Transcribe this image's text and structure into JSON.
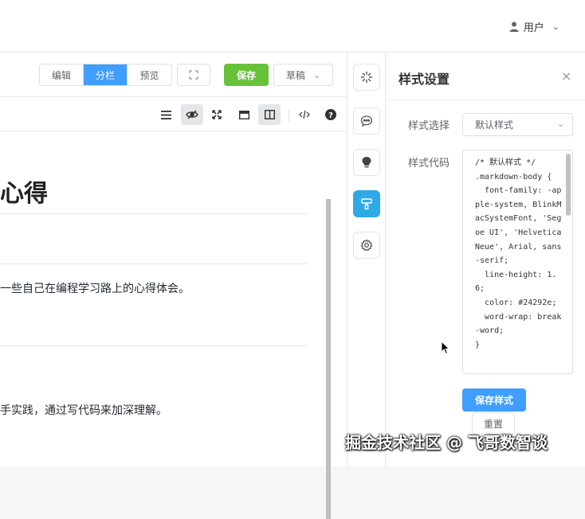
{
  "header": {
    "user_label": "用户",
    "user_icon": "person-icon"
  },
  "editor": {
    "mode_tabs": [
      {
        "label": "编辑",
        "active": false
      },
      {
        "label": "分栏",
        "active": true
      },
      {
        "label": "预览",
        "active": false
      }
    ],
    "save_label": "保存",
    "draft_label": "草稿",
    "toolbar_icons": [
      "menu-icon",
      "eye-off-icon",
      "expand-icon",
      "window-icon",
      "columns-icon",
      "code-icon",
      "help-icon"
    ],
    "preview": {
      "heading": "心得",
      "para1": "一些自己在编程学习路上的心得体会。",
      "para2": "手实践，通过写代码来加深理解。"
    }
  },
  "rail": {
    "buttons": [
      "sparkle-icon",
      "chat-icon",
      "bulb-icon",
      "style-icon",
      "settings-icon"
    ],
    "active": "style-icon"
  },
  "panel": {
    "title": "样式设置",
    "style_select_label": "样式选择",
    "style_select_value": "默认样式",
    "style_code_label": "样式代码",
    "style_code": "/* 默认样式 */\n.markdown-body {\n  font-family: -apple-system, BlinkMacSystemFont, 'Segoe UI', 'Helvetica Neue', Arial, sans-serif;\n  line-height: 1.6;\n  color: #24292e;\n  word-wrap: break-word;\n}",
    "save_style_label": "保存样式",
    "reset_label": "重置"
  },
  "watermark": "掘金技术社区 @ 飞哥数智谈",
  "colors": {
    "primary": "#409eff",
    "success": "#67c23a",
    "rail_active": "#2ea8e6"
  }
}
